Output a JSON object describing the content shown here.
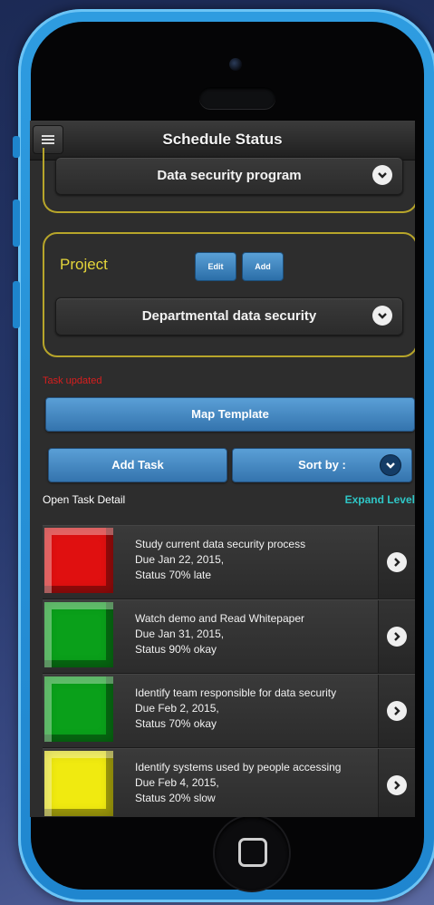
{
  "header": {
    "title": "Schedule Status"
  },
  "program": {
    "selected": "Data security program"
  },
  "project": {
    "label": "Project",
    "edit_label": "Edit",
    "add_label": "Add",
    "selected": "Departmental data security"
  },
  "status_message": "Task updated",
  "actions": {
    "map_template": "Map Template",
    "add_task": "Add Task",
    "sort_by": "Sort by :"
  },
  "list_header": {
    "left": "Open Task Detail",
    "right": "Expand Level"
  },
  "tasks": [
    {
      "title": "Study current data security process",
      "due": "Due Jan 22, 2015,",
      "status": "Status 70% late",
      "status_color": "#e01010"
    },
    {
      "title": "Watch demo and Read Whitepaper",
      "due": "Due Jan 31, 2015,",
      "status": "Status 90% okay",
      "status_color": "#0aa01a"
    },
    {
      "title": "Identify team responsible for data security",
      "due": "Due Feb 2, 2015,",
      "status": "Status 70% okay",
      "status_color": "#0aa01a"
    },
    {
      "title": "Identify systems used by people accessing",
      "due": "Due Feb 4, 2015,",
      "status": "Status 20% slow",
      "status_color": "#f0ea10"
    }
  ],
  "colors": {
    "accent_blue": "#3a7fbf",
    "frame_gold": "#b7a52a",
    "alert_red": "#d81e1e",
    "link_teal": "#2ec6c6"
  }
}
